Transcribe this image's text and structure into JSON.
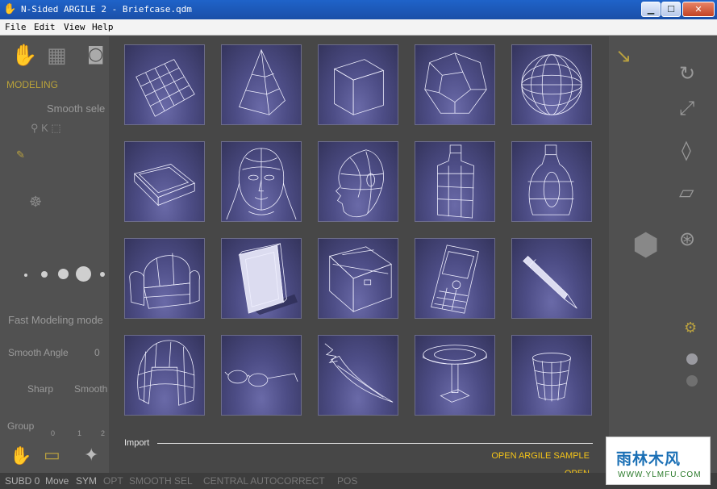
{
  "window": {
    "title": "N-Sided ARGILE 2 - Briefcase.qdm",
    "buttons": {
      "minimize": "▁",
      "maximize": "☐",
      "close": "✕"
    }
  },
  "menu": [
    "File",
    "Edit",
    "View",
    "Help"
  ],
  "background": {
    "modeling": "MODELING",
    "smooth_select": "Smooth sele",
    "fast_modeling": "Fast Modeling mode",
    "smooth_angle": "Smooth Angle",
    "smooth_angle_value": "0",
    "sharp": "Sharp",
    "smooth": "Smooth",
    "group": "Group",
    "group_values": [
      "0",
      "1",
      "2"
    ]
  },
  "gallery": {
    "samples": [
      "plane-grid",
      "pyramid",
      "cube",
      "dodecahedron",
      "sphere",
      "tray",
      "female-head",
      "head-profile",
      "bottle",
      "jug",
      "armchair",
      "book",
      "briefcase",
      "cell-phone",
      "pen",
      "hair",
      "glasses",
      "sword",
      "table",
      "glass"
    ],
    "import_label": "Import",
    "open_sample": "OPEN ARGILE SAMPLE",
    "open": "OPEN"
  },
  "statusbar": [
    "SUBD 0",
    "Move",
    "SYM",
    "OPT",
    "SMOOTH SEL",
    "CENTRAL AUTOCORRECT",
    "POS"
  ],
  "watermark": {
    "text": "雨林木风",
    "url": "WWW.YLMFU.COM"
  }
}
